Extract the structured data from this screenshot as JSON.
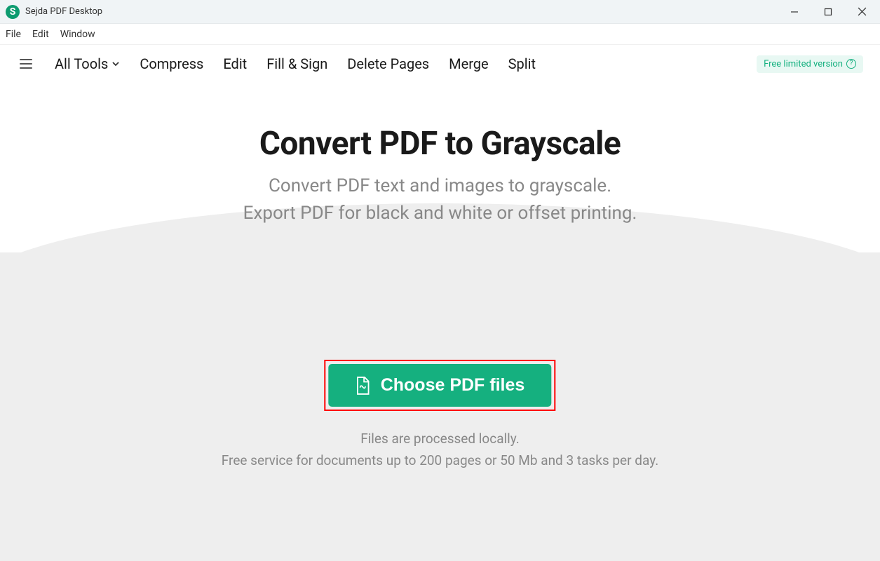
{
  "titlebar": {
    "app_icon_letter": "S",
    "app_title": "Sejda PDF Desktop"
  },
  "menubar": {
    "items": [
      "File",
      "Edit",
      "Window"
    ]
  },
  "toolbar": {
    "all_tools": "All Tools",
    "items": [
      "Compress",
      "Edit",
      "Fill & Sign",
      "Delete Pages",
      "Merge",
      "Split"
    ],
    "version_badge": "Free limited version"
  },
  "main": {
    "title": "Convert PDF to Grayscale",
    "subtitle_line1": "Convert PDF text and images to grayscale.",
    "subtitle_line2": "Export PDF for black and white or offset printing."
  },
  "upload": {
    "button_label": "Choose PDF files",
    "info1": "Files are processed locally.",
    "info2": "Free service for documents up to 200 pages or 50 Mb and 3 tasks per day."
  }
}
